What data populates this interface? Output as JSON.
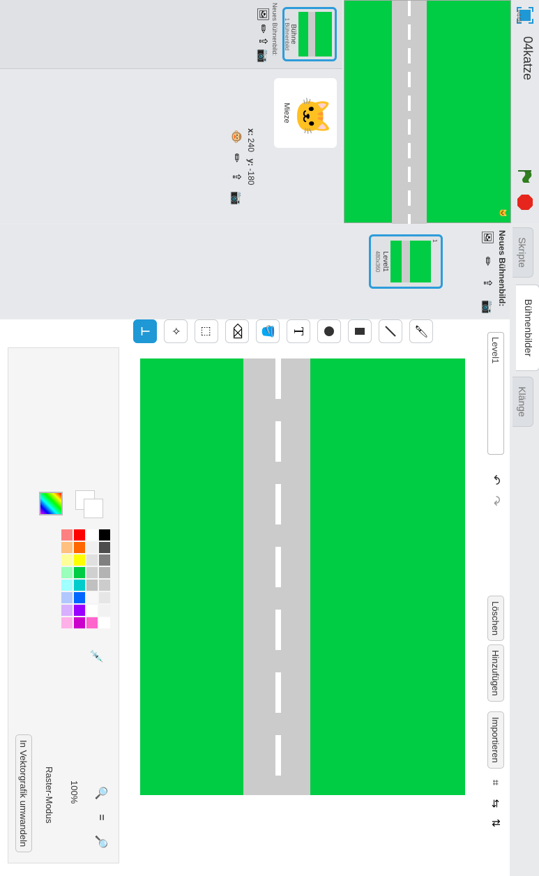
{
  "project": {
    "title": "04katze",
    "version": "v448"
  },
  "stage": {
    "coords_x_label": "x:",
    "coords_x": "240",
    "coords_y_label": "y:",
    "coords_y": "-180"
  },
  "sprites": {
    "new_backdrop_label": "Neues Bühnenbild:",
    "stage_item": {
      "name": "Bühne",
      "sub": "1 Bühnenbild"
    },
    "sprite_item": {
      "name": "Mieze"
    }
  },
  "tabs": [
    {
      "label": "Skripte"
    },
    {
      "label": "Bühnenbilder"
    },
    {
      "label": "Klänge"
    }
  ],
  "backdrops": {
    "new_label": "Neues Bühnenbild:",
    "items": [
      {
        "index": "1",
        "name": "Level1",
        "size": "480x360"
      }
    ]
  },
  "editor": {
    "costume_name": "Level1",
    "buttons": {
      "clear": "Löschen",
      "add": "Hinzufügen",
      "import": "Importieren"
    },
    "zoom": "100%",
    "mode": "Raster-Modus",
    "convert": "In Vektorgrafik umwandeln"
  },
  "colors": {
    "green": "#00cc44",
    "road": "#cbcbcb",
    "active_blue": "#1f98d6",
    "selection_blue": "#2d9cdb",
    "stop_red": "#e6261d"
  },
  "palette": [
    [
      "#000000",
      "#ffffff",
      "#ff0000",
      "#ff8080"
    ],
    [
      "#4d4d4d",
      "#f0f0f0",
      "#ff6600",
      "#ffc080"
    ],
    [
      "#808080",
      "#e0e0e0",
      "#ffff00",
      "#ffff99"
    ],
    [
      "#b3b3b3",
      "#d0d0d0",
      "#00cc44",
      "#99ffbb"
    ],
    [
      "#cccccc",
      "#c0c0c0",
      "#00cccc",
      "#a0ffff"
    ],
    [
      "#e6e6e6",
      "#f8f8f8",
      "#0066ff",
      "#b0c8ff"
    ],
    [
      "#f2f2f2",
      "#ffffff",
      "#9900ff",
      "#d8b0ff"
    ],
    [
      "#ffffff",
      "#ff66cc",
      "#cc00cc",
      "#ffb0e8"
    ]
  ]
}
